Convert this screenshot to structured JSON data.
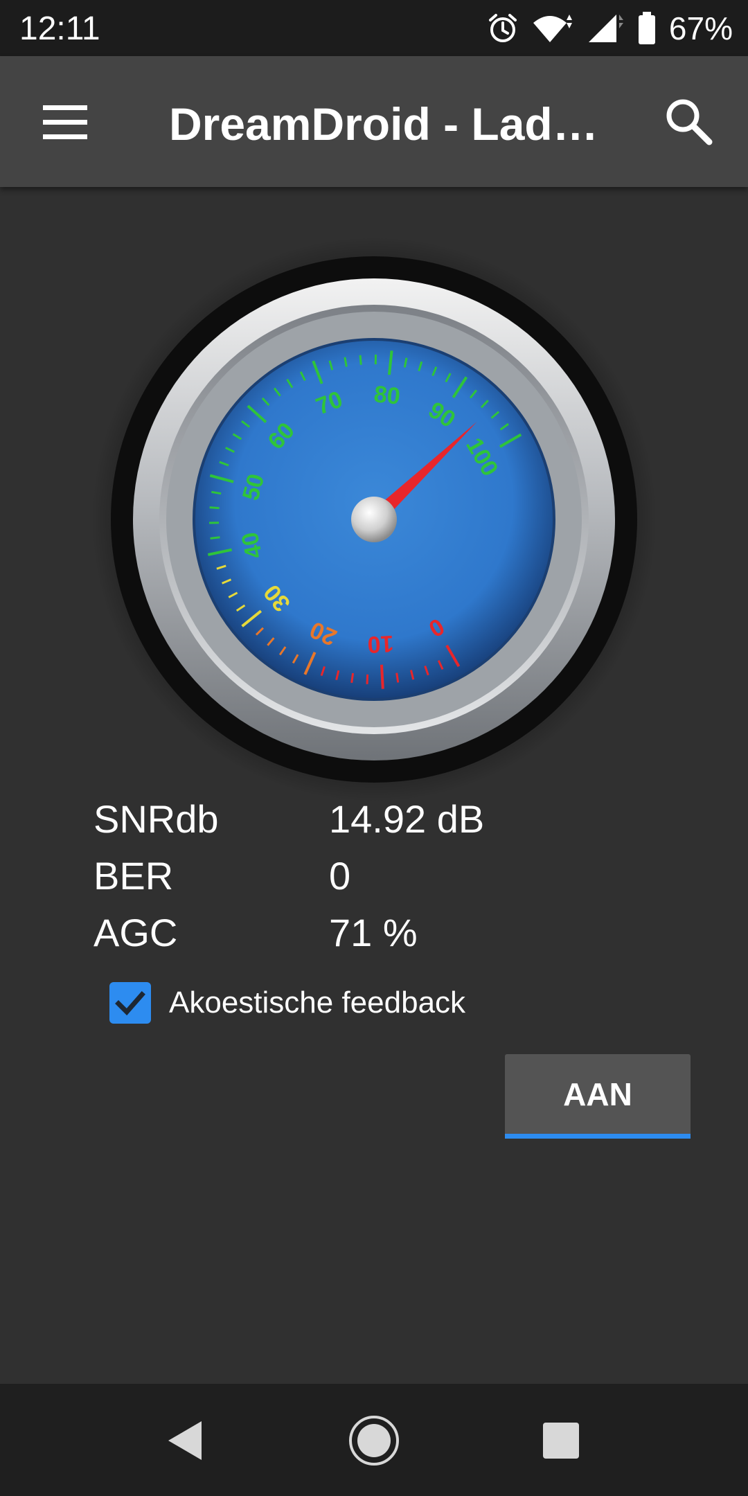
{
  "status_bar": {
    "time": "12:11",
    "battery_percent": "67%",
    "icons": [
      "alarm-icon",
      "wifi-icon",
      "signal-icon",
      "battery-icon"
    ]
  },
  "app_bar": {
    "title": "DreamDroid - Lade…",
    "menu_icon": "hamburger-menu-icon",
    "search_icon": "search-icon"
  },
  "gauge": {
    "scale_labels": [
      "0",
      "10",
      "20",
      "30",
      "40",
      "50",
      "60",
      "70",
      "80",
      "90",
      "100"
    ],
    "needle_value": 95,
    "colors": {
      "low": "#e8262b",
      "mid_low": "#e8772a",
      "mid": "#e6d93a",
      "high": "#2fc43a",
      "face": "#2f7bcf",
      "needle": "#e8262b"
    }
  },
  "metrics": [
    {
      "label": "SNRdb",
      "value": "14.92 dB"
    },
    {
      "label": "BER",
      "value": "0"
    },
    {
      "label": "AGC",
      "value": "71 %"
    }
  ],
  "feedback": {
    "label": "Akoestische feedback",
    "checked": true
  },
  "toggle_button": {
    "label": "AAN"
  },
  "nav_bar": {
    "icons": [
      "back-icon",
      "home-icon",
      "recents-icon"
    ]
  },
  "accent_color": "#2d8cf0"
}
